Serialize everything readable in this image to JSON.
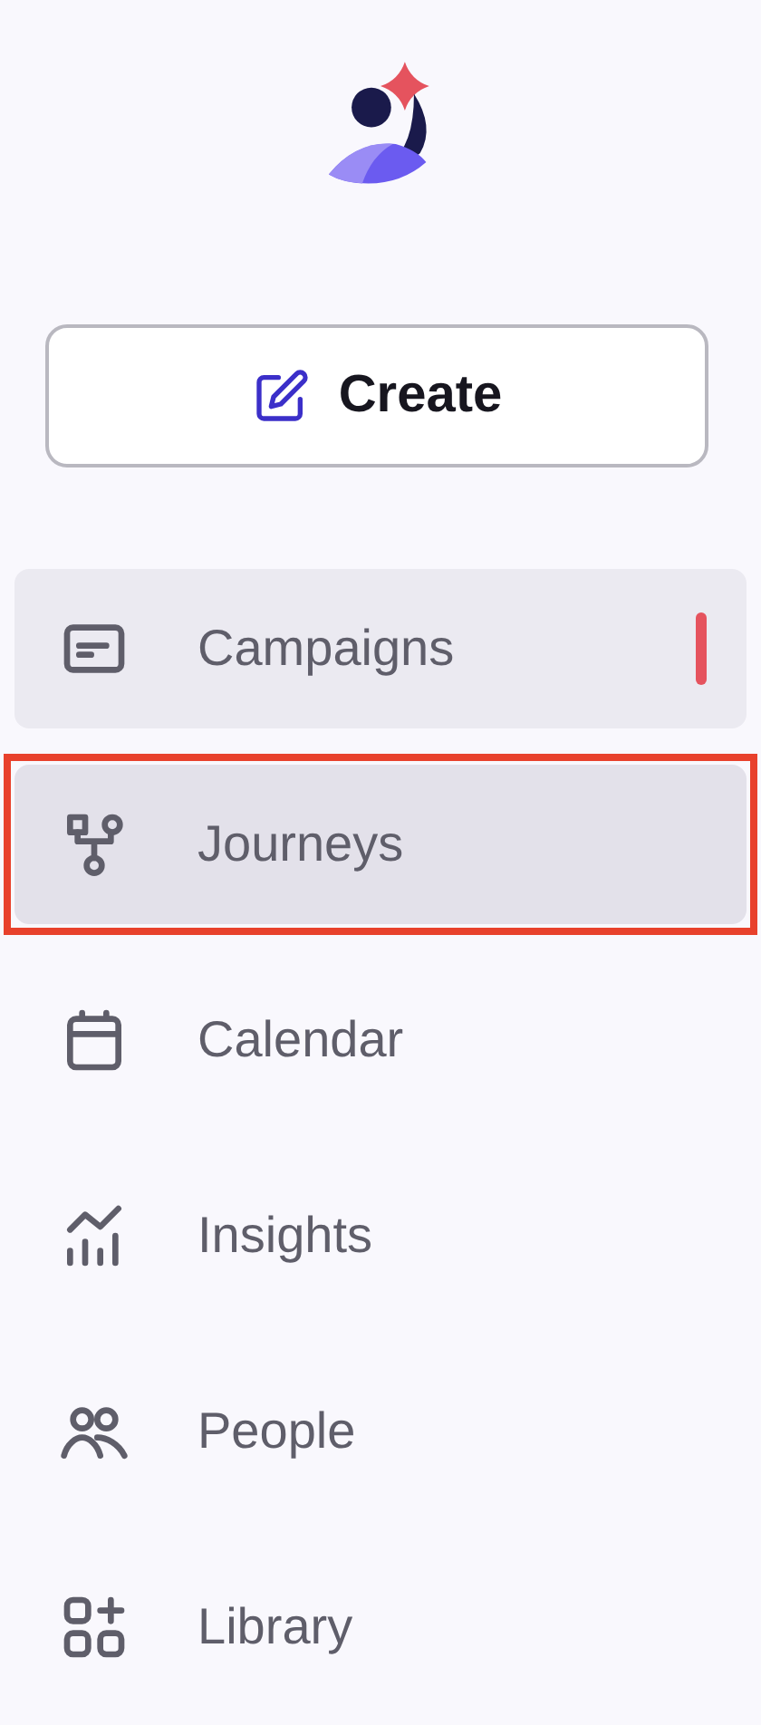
{
  "create_button": {
    "label": "Create"
  },
  "nav": {
    "items": [
      {
        "kind": "campaigns",
        "label": "Campaigns",
        "selected": false,
        "highlighted": true,
        "indicator": true,
        "outlined": false
      },
      {
        "kind": "journeys",
        "label": "Journeys",
        "selected": true,
        "highlighted": false,
        "indicator": false,
        "outlined": true
      },
      {
        "kind": "calendar",
        "label": "Calendar",
        "selected": false,
        "highlighted": false,
        "indicator": false,
        "outlined": false
      },
      {
        "kind": "insights",
        "label": "Insights",
        "selected": false,
        "highlighted": false,
        "indicator": false,
        "outlined": false
      },
      {
        "kind": "people",
        "label": "People",
        "selected": false,
        "highlighted": false,
        "indicator": false,
        "outlined": false
      },
      {
        "kind": "library",
        "label": "Library",
        "selected": false,
        "highlighted": false,
        "indicator": false,
        "outlined": false
      }
    ]
  }
}
